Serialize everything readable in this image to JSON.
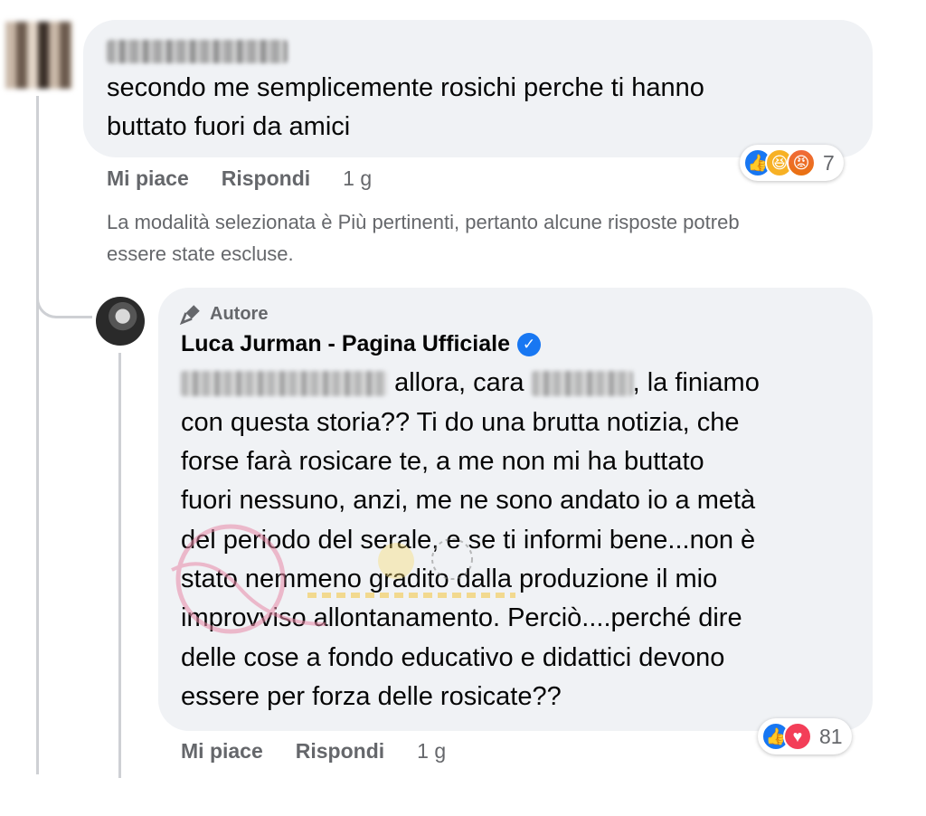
{
  "comment_1": {
    "text_line_1": "secondo me semplicemente rosichi perche ti hanno",
    "text_line_2": "buttato fuori da amici",
    "actions": {
      "like": "Mi piace",
      "reply": "Rispondi",
      "time": "1 g"
    },
    "reactions": {
      "icons": [
        "like-icon",
        "haha-icon",
        "angry-icon"
      ],
      "count": "7"
    }
  },
  "sort_notice": {
    "line_1": "La modalità selezionata è Più pertinenti, pertanto alcune risposte potreb",
    "line_2": "essere state escluse."
  },
  "reply": {
    "badge": "Autore",
    "author": "Luca Jurman - Pagina Ufficiale",
    "lines": {
      "l1_a": "allora, cara",
      "l1_b": ", la finiamo",
      "l2": "con questa storia?? Ti do una brutta notizia, che",
      "l3": "forse farà rosicare te, a me non mi ha buttato",
      "l4": "fuori nessuno, anzi, me ne sono andato io a metà",
      "l5": "del periodo del serale, e se ti informi bene...non è",
      "l6": "stato nemmeno gradito dalla produzione il mio",
      "l7": "improvviso allontanamento. Perciò....perché dire",
      "l8": "delle cose a fondo educativo e didattici devono",
      "l9": "essere per forza delle rosicate??"
    },
    "actions": {
      "like": "Mi piace",
      "reply": "Rispondi",
      "time": "1 g"
    },
    "reactions": {
      "icons": [
        "like-icon",
        "love-icon"
      ],
      "count": "81"
    }
  },
  "colors": {
    "bubble": "#f0f2f5",
    "secondary_text": "#65676b",
    "like_blue": "#1877f2",
    "love_red": "#f33e58"
  }
}
